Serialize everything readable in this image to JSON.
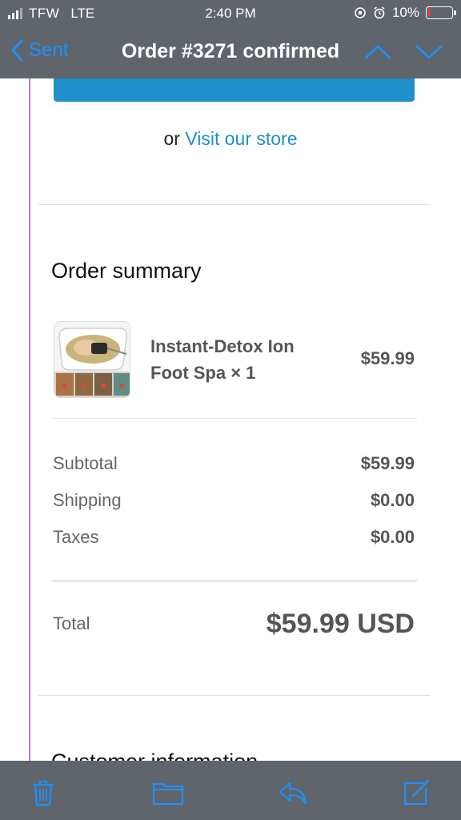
{
  "status_bar": {
    "carrier": "TFW",
    "network": "LTE",
    "time": "2:40 PM",
    "battery": "10%",
    "battery_level": 0.1,
    "battery_color": "#ff3b30"
  },
  "nav": {
    "back_label": "Sent",
    "title": "Order #3271 confirmed"
  },
  "email": {
    "or_text": "or",
    "store_link": "Visit our store",
    "order_summary_title": "Order summary",
    "product": {
      "name": "Instant-Detox Ion Foot Spa × 1",
      "price": "$59.99"
    },
    "subtotal": {
      "label": "Subtotal",
      "value": "$59.99"
    },
    "shipping": {
      "label": "Shipping",
      "value": "$0.00"
    },
    "taxes": {
      "label": "Taxes",
      "value": "$0.00"
    },
    "total": {
      "label": "Total",
      "value": "$59.99 USD"
    },
    "customer_info_title": "Customer information"
  },
  "colors": {
    "header_bg": "#5f656b",
    "accent": "#1e90ff",
    "button_blue": "#1f90c9",
    "thread_line": "#b77ce0"
  },
  "icons": {
    "back": "chevron-left-icon",
    "up": "chevron-up-icon",
    "down": "chevron-down-icon",
    "trash": "trash-icon",
    "folder": "folder-icon",
    "reply": "reply-icon",
    "compose": "compose-icon"
  }
}
